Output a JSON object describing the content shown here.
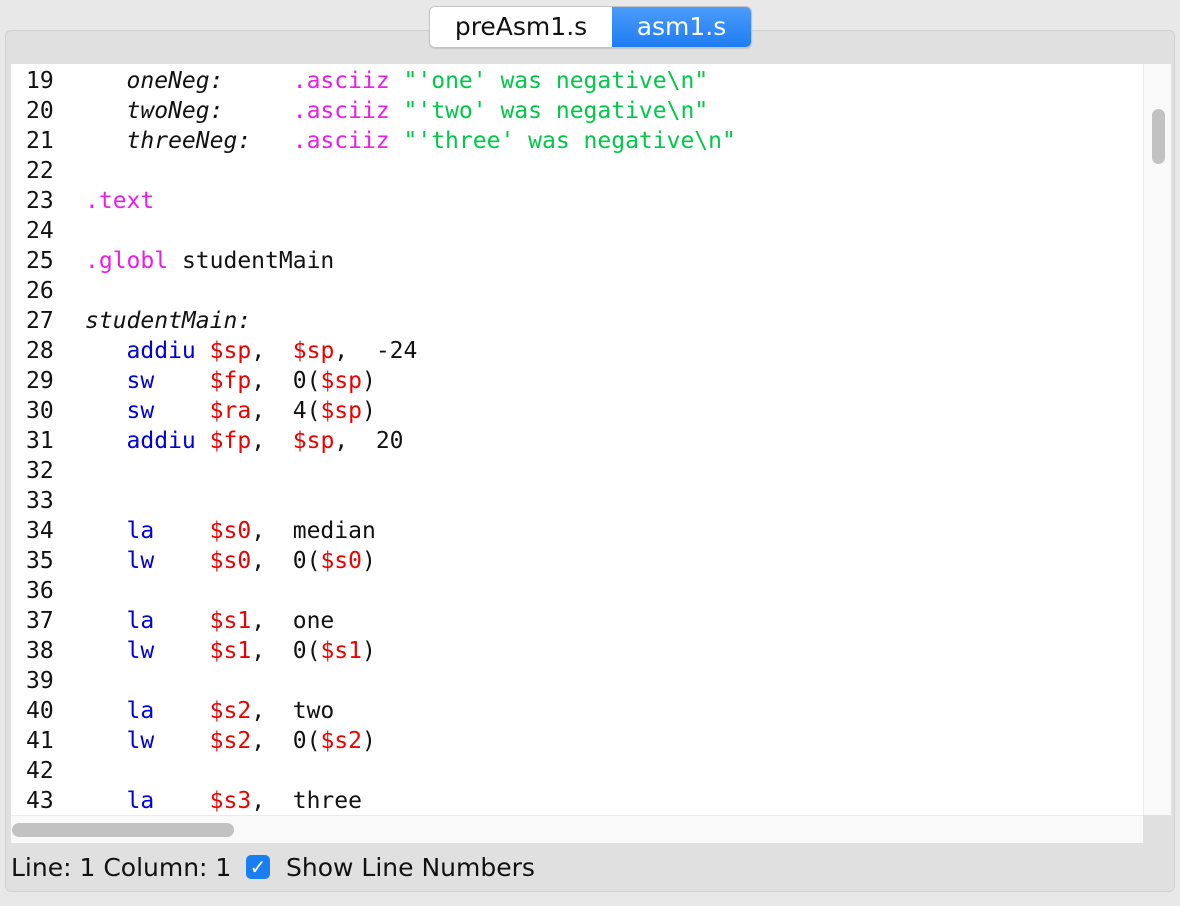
{
  "tabs": [
    {
      "label": "preAsm1.s",
      "active": false
    },
    {
      "label": "asm1.s",
      "active": true
    }
  ],
  "editor": {
    "lines": [
      {
        "num": "19",
        "segments": [
          [
            "label",
            "   oneNeg:"
          ],
          [
            "plain",
            "     "
          ],
          [
            "dir",
            ".asciiz"
          ],
          [
            "plain",
            " "
          ],
          [
            "str",
            "\"'one' was negative\\n\""
          ]
        ]
      },
      {
        "num": "20",
        "segments": [
          [
            "label",
            "   twoNeg:"
          ],
          [
            "plain",
            "     "
          ],
          [
            "dir",
            ".asciiz"
          ],
          [
            "plain",
            " "
          ],
          [
            "str",
            "\"'two' was negative\\n\""
          ]
        ]
      },
      {
        "num": "21",
        "segments": [
          [
            "label",
            "   threeNeg:"
          ],
          [
            "plain",
            "   "
          ],
          [
            "dir",
            ".asciiz"
          ],
          [
            "plain",
            " "
          ],
          [
            "str",
            "\"'three' was negative\\n\""
          ]
        ]
      },
      {
        "num": "22",
        "segments": []
      },
      {
        "num": "23",
        "segments": [
          [
            "dir",
            ".text"
          ]
        ]
      },
      {
        "num": "24",
        "segments": []
      },
      {
        "num": "25",
        "segments": [
          [
            "dir",
            ".globl"
          ],
          [
            "plain",
            " studentMain"
          ]
        ]
      },
      {
        "num": "26",
        "segments": []
      },
      {
        "num": "27",
        "segments": [
          [
            "label",
            "studentMain:"
          ]
        ]
      },
      {
        "num": "28",
        "segments": [
          [
            "plain",
            "   "
          ],
          [
            "kw",
            "addiu"
          ],
          [
            "plain",
            " "
          ],
          [
            "reg",
            "$sp"
          ],
          [
            "plain",
            ",  "
          ],
          [
            "reg",
            "$sp"
          ],
          [
            "plain",
            ",  -24"
          ]
        ]
      },
      {
        "num": "29",
        "segments": [
          [
            "plain",
            "   "
          ],
          [
            "kw",
            "sw"
          ],
          [
            "plain",
            "    "
          ],
          [
            "reg",
            "$fp"
          ],
          [
            "plain",
            ",  0("
          ],
          [
            "reg",
            "$sp"
          ],
          [
            "plain",
            ")"
          ]
        ]
      },
      {
        "num": "30",
        "segments": [
          [
            "plain",
            "   "
          ],
          [
            "kw",
            "sw"
          ],
          [
            "plain",
            "    "
          ],
          [
            "reg",
            "$ra"
          ],
          [
            "plain",
            ",  4("
          ],
          [
            "reg",
            "$sp"
          ],
          [
            "plain",
            ")"
          ]
        ]
      },
      {
        "num": "31",
        "segments": [
          [
            "plain",
            "   "
          ],
          [
            "kw",
            "addiu"
          ],
          [
            "plain",
            " "
          ],
          [
            "reg",
            "$fp"
          ],
          [
            "plain",
            ",  "
          ],
          [
            "reg",
            "$sp"
          ],
          [
            "plain",
            ",  20"
          ]
        ]
      },
      {
        "num": "32",
        "segments": []
      },
      {
        "num": "33",
        "segments": []
      },
      {
        "num": "34",
        "segments": [
          [
            "plain",
            "   "
          ],
          [
            "kw",
            "la"
          ],
          [
            "plain",
            "    "
          ],
          [
            "reg",
            "$s0"
          ],
          [
            "plain",
            ",  median"
          ]
        ]
      },
      {
        "num": "35",
        "segments": [
          [
            "plain",
            "   "
          ],
          [
            "kw",
            "lw"
          ],
          [
            "plain",
            "    "
          ],
          [
            "reg",
            "$s0"
          ],
          [
            "plain",
            ",  0("
          ],
          [
            "reg",
            "$s0"
          ],
          [
            "plain",
            ")"
          ]
        ]
      },
      {
        "num": "36",
        "segments": []
      },
      {
        "num": "37",
        "segments": [
          [
            "plain",
            "   "
          ],
          [
            "kw",
            "la"
          ],
          [
            "plain",
            "    "
          ],
          [
            "reg",
            "$s1"
          ],
          [
            "plain",
            ",  one"
          ]
        ]
      },
      {
        "num": "38",
        "segments": [
          [
            "plain",
            "   "
          ],
          [
            "kw",
            "lw"
          ],
          [
            "plain",
            "    "
          ],
          [
            "reg",
            "$s1"
          ],
          [
            "plain",
            ",  0("
          ],
          [
            "reg",
            "$s1"
          ],
          [
            "plain",
            ")"
          ]
        ]
      },
      {
        "num": "39",
        "segments": []
      },
      {
        "num": "40",
        "segments": [
          [
            "plain",
            "   "
          ],
          [
            "kw",
            "la"
          ],
          [
            "plain",
            "    "
          ],
          [
            "reg",
            "$s2"
          ],
          [
            "plain",
            ",  two"
          ]
        ]
      },
      {
        "num": "41",
        "segments": [
          [
            "plain",
            "   "
          ],
          [
            "kw",
            "lw"
          ],
          [
            "plain",
            "    "
          ],
          [
            "reg",
            "$s2"
          ],
          [
            "plain",
            ",  0("
          ],
          [
            "reg",
            "$s2"
          ],
          [
            "plain",
            ")"
          ]
        ]
      },
      {
        "num": "42",
        "segments": []
      },
      {
        "num": "43",
        "segments": [
          [
            "plain",
            "   "
          ],
          [
            "kw",
            "la"
          ],
          [
            "plain",
            "    "
          ],
          [
            "reg",
            "$s3"
          ],
          [
            "plain",
            ",  three"
          ]
        ]
      }
    ]
  },
  "status": {
    "text": "Line: 1 Column: 1",
    "show_line_numbers_label": "Show Line Numbers",
    "show_line_numbers_checked": true
  },
  "colors": {
    "keyword": "#0000dd",
    "register": "#ee0000",
    "directive": "#e91ee9",
    "string": "#00c848",
    "accent": "#1a7ef3"
  },
  "icons": {
    "checkbox": "checkmark-icon"
  }
}
